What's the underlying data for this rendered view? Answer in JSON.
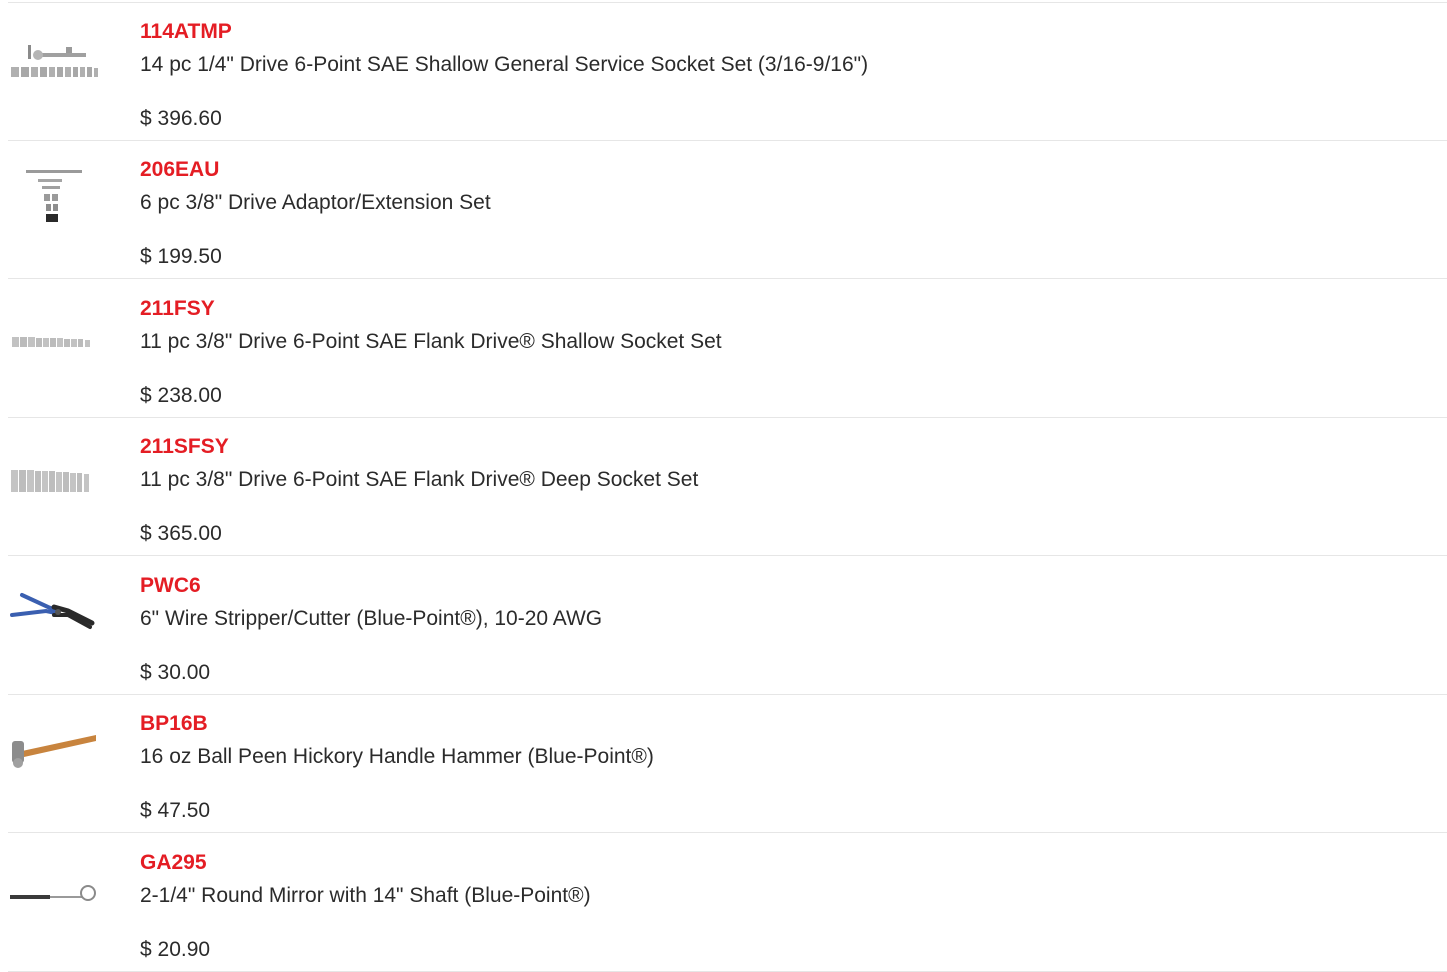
{
  "products": [
    {
      "sku": "114ATMP",
      "description": "14 pc 1/4\" Drive 6-Point SAE Shallow General Service Socket Set (3/16-9/16\")",
      "price": "$ 396.60",
      "image": "socket-set-with-ratchet-thumbnail"
    },
    {
      "sku": "206EAU",
      "description": "6 pc 3/8\" Drive Adaptor/Extension Set",
      "price": "$ 199.50",
      "image": "adaptor-extension-set-thumbnail"
    },
    {
      "sku": "211FSY",
      "description": "11 pc 3/8\" Drive 6-Point SAE Flank Drive® Shallow Socket Set",
      "price": "$ 238.00",
      "image": "shallow-socket-set-thumbnail"
    },
    {
      "sku": "211SFSY",
      "description": "11 pc 3/8\" Drive 6-Point SAE Flank Drive® Deep Socket Set",
      "price": "$ 365.00",
      "image": "deep-socket-set-thumbnail"
    },
    {
      "sku": "PWC6",
      "description": "6\" Wire Stripper/Cutter (Blue-Point®), 10-20 AWG",
      "price": "$ 30.00",
      "image": "wire-stripper-thumbnail"
    },
    {
      "sku": "BP16B",
      "description": "16 oz Ball Peen Hickory Handle Hammer (Blue-Point®)",
      "price": "$ 47.50",
      "image": "ball-peen-hammer-thumbnail"
    },
    {
      "sku": "GA295",
      "description": "2-1/4\" Round Mirror with 14\" Shaft (Blue-Point®)",
      "price": "$ 20.90",
      "image": "inspection-mirror-thumbnail"
    }
  ],
  "colors": {
    "sku": "#e41d24",
    "text": "#2b2b2b",
    "divider": "#e6e6e6",
    "wire_stripper_handle": "#3a5fb0",
    "hammer_handle": "#c8843e"
  }
}
